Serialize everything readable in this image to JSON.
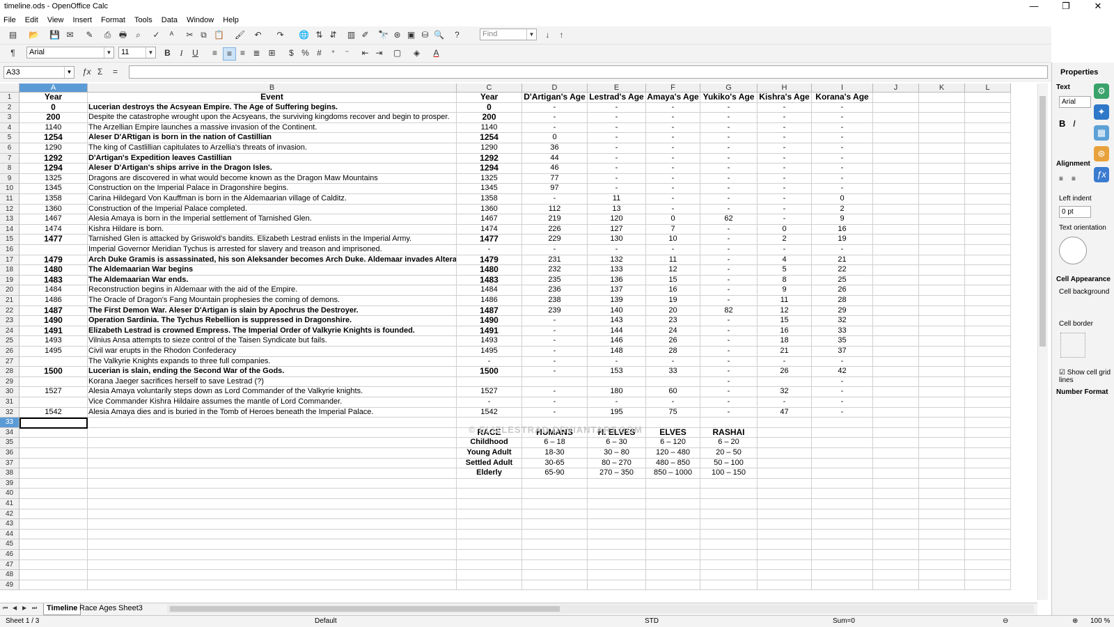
{
  "window": {
    "title": "timeline.ods - OpenOffice Calc",
    "minimize": "—",
    "restore": "❐",
    "close": "✕"
  },
  "menu": [
    "File",
    "Edit",
    "View",
    "Insert",
    "Format",
    "Tools",
    "Data",
    "Window",
    "Help"
  ],
  "toolbar": {
    "find_placeholder": "Find"
  },
  "format": {
    "font": "Arial",
    "size": "11"
  },
  "formula": {
    "cell_ref": "A33",
    "fx": "ƒx",
    "sum": "Σ",
    "eq": "=",
    "value": ""
  },
  "columns": [
    "A",
    "B",
    "C",
    "D",
    "E",
    "F",
    "G",
    "H",
    "I",
    "J",
    "K",
    "L"
  ],
  "headers": [
    "Year",
    "Event",
    "Year",
    "D'Artigan's Age",
    "Lestrad's Age",
    "Amaya's Age",
    "Yukiko's Age",
    "Kishra's Age",
    "Korana's Age"
  ],
  "rows": [
    {
      "a": "0",
      "b": "Lucerian destroys the Acsyean Empire.  The Age of Suffering begins.",
      "c": "0",
      "d": "-",
      "e": "-",
      "f": "-",
      "g": "-",
      "h": "-",
      "i": "-",
      "bold": true
    },
    {
      "a": "200",
      "b": "Despite the catastrophe wrought upon the Acsyeans, the surviving kingdoms recover and begin to prosper.",
      "c": "200",
      "d": "-",
      "e": "-",
      "f": "-",
      "g": "-",
      "h": "-",
      "i": "-",
      "bold": false,
      "boldyear": true
    },
    {
      "a": "1140",
      "b": "The Arzellian Empire launches a massive invasion of the Continent.",
      "c": "1140",
      "d": "-",
      "e": "-",
      "f": "-",
      "g": "-",
      "h": "-",
      "i": "-",
      "bold": false
    },
    {
      "a": "1254",
      "b": "Aleser D'ARtigan is born in the nation of Castillian",
      "c": "1254",
      "d": "0",
      "e": "-",
      "f": "-",
      "g": "-",
      "h": "-",
      "i": "-",
      "bold": true
    },
    {
      "a": "1290",
      "b": "The king of Castlillian capitulates to Arzellia's threats of invasion.",
      "c": "1290",
      "d": "36",
      "e": "-",
      "f": "-",
      "g": "-",
      "h": "-",
      "i": "-",
      "bold": false
    },
    {
      "a": "1292",
      "b": "D'Artigan's Expedition leaves Castillian",
      "c": "1292",
      "d": "44",
      "e": "-",
      "f": "-",
      "g": "-",
      "h": "-",
      "i": "-",
      "bold": true
    },
    {
      "a": "1294",
      "b": "Aleser D'Artigan's ships arrive in the Dragon Isles.",
      "c": "1294",
      "d": "46",
      "e": "-",
      "f": "-",
      "g": "-",
      "h": "-",
      "i": "-",
      "bold": true
    },
    {
      "a": "1325",
      "b": "Dragons are discovered in what would become known as the Dragon Maw Mountains",
      "c": "1325",
      "d": "77",
      "e": "-",
      "f": "-",
      "g": "-",
      "h": "-",
      "i": "-",
      "bold": false
    },
    {
      "a": "1345",
      "b": "Construction on the Imperial Palace in Dragonshire begins.",
      "c": "1345",
      "d": "97",
      "e": "-",
      "f": "-",
      "g": "-",
      "h": "-",
      "i": "-",
      "bold": false
    },
    {
      "a": "1358",
      "b": "Carina Hildegard Von Kauffman is born in the Aldemaarian village of Calditz.",
      "c": "1358",
      "d": "-",
      "e": "11",
      "f": "-",
      "g": "-",
      "h": "-",
      "i": "0",
      "bold": false
    },
    {
      "a": "1360",
      "b": "Construction of the Imperial Palace completed.",
      "c": "1360",
      "d": "112",
      "e": "13",
      "f": "-",
      "g": "-",
      "h": "-",
      "i": "2",
      "bold": false
    },
    {
      "a": "1467",
      "b": "Alesia Amaya is born in the Imperial settlement of Tarnished Glen.",
      "c": "1467",
      "d": "219",
      "e": "120",
      "f": "0",
      "g": "62",
      "h": "-",
      "i": "9",
      "bold": false
    },
    {
      "a": "1474",
      "b": "Kishra Hildare is born.",
      "c": "1474",
      "d": "226",
      "e": "127",
      "f": "7",
      "g": "-",
      "h": "0",
      "i": "16",
      "bold": false
    },
    {
      "a": "1477",
      "b": "Tarnished Glen is attacked by Griswold's bandits.  Elizabeth Lestrad enlists in the Imperial Army.",
      "c": "1477",
      "d": "229",
      "e": "130",
      "f": "10",
      "g": "-",
      "h": "2",
      "i": "19",
      "bold": false,
      "boldyear": true
    },
    {
      "a": "",
      "b": "Imperial Governor Meridian Tychus is arrested for slavery and treason and imprisoned.",
      "c": "-",
      "d": "-",
      "e": "-",
      "f": "-",
      "g": "-",
      "h": "-",
      "i": "-",
      "bold": false
    },
    {
      "a": "1479",
      "b": "Arch Duke Gramis is assassinated, his son Aleksander becomes Arch Duke.  Aldemaar invades Altera.",
      "c": "1479",
      "d": "231",
      "e": "132",
      "f": "11",
      "g": "-",
      "h": "4",
      "i": "21",
      "bold": true
    },
    {
      "a": "1480",
      "b": "The Aldemaarian War begins",
      "c": "1480",
      "d": "232",
      "e": "133",
      "f": "12",
      "g": "-",
      "h": "5",
      "i": "22",
      "bold": true
    },
    {
      "a": "1483",
      "b": "The Aldemaarian War ends.",
      "c": "1483",
      "d": "235",
      "e": "136",
      "f": "15",
      "g": "-",
      "h": "8",
      "i": "25",
      "bold": true
    },
    {
      "a": "1484",
      "b": "Reconstruction begins in Aldemaar with the aid of the Empire.",
      "c": "1484",
      "d": "236",
      "e": "137",
      "f": "16",
      "g": "-",
      "h": "9",
      "i": "26",
      "bold": false
    },
    {
      "a": "1486",
      "b": "The Oracle of Dragon's Fang Mountain prophesies the coming of demons.",
      "c": "1486",
      "d": "238",
      "e": "139",
      "f": "19",
      "g": "-",
      "h": "11",
      "i": "28",
      "bold": false
    },
    {
      "a": "1487",
      "b": "The First Demon War.  Aleser D'Artigan is slain by Apochrus the Destroyer.",
      "c": "1487",
      "d": "239",
      "e": "140",
      "f": "20",
      "g": "82",
      "h": "12",
      "i": "29",
      "bold": true
    },
    {
      "a": "1490",
      "b": "Operation Sardinia. The Tychus Rebellion is suppressed in Dragonshire.",
      "c": "1490",
      "d": "-",
      "e": "143",
      "f": "23",
      "g": "-",
      "h": "15",
      "i": "32",
      "bold": true
    },
    {
      "a": "1491",
      "b": "Elizabeth Lestrad is crowned Empress.  The Imperial Order of Valkyrie Knights is founded.",
      "c": "1491",
      "d": "-",
      "e": "144",
      "f": "24",
      "g": "-",
      "h": "16",
      "i": "33",
      "bold": true
    },
    {
      "a": "1493",
      "b": "Vilnius Ansa attempts to sieze control of the Taisen Syndicate but fails.",
      "c": "1493",
      "d": "-",
      "e": "146",
      "f": "26",
      "g": "-",
      "h": "18",
      "i": "35",
      "bold": false
    },
    {
      "a": "1495",
      "b": "Civil war erupts in the Rhodon Confederacy",
      "c": "1495",
      "d": "-",
      "e": "148",
      "f": "28",
      "g": "-",
      "h": "21",
      "i": "37",
      "bold": false
    },
    {
      "a": "",
      "b": "The Valkyrie Knights expands to three full companies.",
      "c": "-",
      "d": "-",
      "e": "-",
      "f": "-",
      "g": "-",
      "h": "-",
      "i": "-",
      "bold": false
    },
    {
      "a": "1500",
      "b": "Lucerian is slain, ending the Second War of the Gods.",
      "c": "1500",
      "d": "-",
      "e": "153",
      "f": "33",
      "g": "-",
      "h": "26",
      "i": "42",
      "bold": true
    },
    {
      "a": "",
      "b": "Korana Jaeger sacrifices herself to save Lestrad (?)",
      "c": "",
      "d": "",
      "e": "",
      "f": "",
      "g": "-",
      "h": "",
      "i": "-",
      "bold": false
    },
    {
      "a": "1527",
      "b": "Alesia Amaya voluntarily steps down as Lord Commander of the Valkyrie knights.",
      "c": "1527",
      "d": "-",
      "e": "180",
      "f": "60",
      "g": "-",
      "h": "32",
      "i": "-",
      "bold": false
    },
    {
      "a": "",
      "b": "Vice Commander Kishra Hildaire assumes the mantle of Lord Commander.",
      "c": "-",
      "d": "-",
      "e": "-",
      "f": "-",
      "g": "-",
      "h": "-",
      "i": "-",
      "bold": false
    },
    {
      "a": "1542",
      "b": "Alesia Amaya dies and is buried in the Tomb of Heroes beneath the Imperial Palace.",
      "c": "1542",
      "d": "-",
      "e": "195",
      "f": "75",
      "g": "-",
      "h": "47",
      "i": "-",
      "bold": false
    }
  ],
  "race_table": {
    "headers": [
      "RACE",
      "HUMANS",
      "H. ELVES",
      "ELVES",
      "RASHAI"
    ],
    "rows": [
      [
        "Childhood",
        "6 – 18",
        "6 – 30",
        "6 – 120",
        "6 – 20"
      ],
      [
        "Young Adult",
        "18-30",
        "30 – 80",
        "120 – 480",
        "20 – 50"
      ],
      [
        "Settled Adult",
        "30-65",
        "80 – 270",
        "480 – 850",
        "50 – 100"
      ],
      [
        "Elderly",
        "65-90",
        "270 – 350",
        "850 – 1000",
        "100 – 150"
      ]
    ]
  },
  "watermark": "© ELIZLESTRAD.DEVIANTART.COM",
  "tabs": [
    "Timeline",
    "Race Ages",
    "Sheet3"
  ],
  "status": {
    "sheet": "Sheet 1 / 3",
    "style": "Default",
    "mode": "STD",
    "sum": "Sum=0",
    "zoom": "100 %"
  },
  "sidebar": {
    "title": "Properties",
    "text_section": "Text",
    "font": "Arial",
    "alignment_section": "Alignment",
    "left_indent": "Left indent",
    "indent_value": "0 pt",
    "text_orient": "Text orientation",
    "cell_appearance": "Cell Appearance",
    "cell_background": "Cell background",
    "cell_border": "Cell border",
    "show_grid": "Show cell grid lines",
    "number_format": "Number Format"
  },
  "colors": {
    "selection": "#5b9bd5",
    "grid": "#d0d0d0",
    "chrome": "#f3f3f3"
  }
}
